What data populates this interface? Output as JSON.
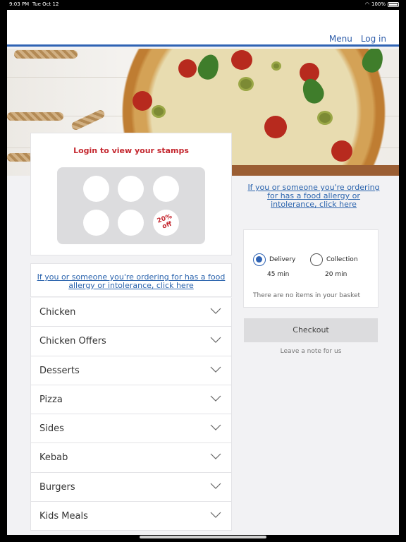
{
  "status_bar": {
    "time": "9:03 PM",
    "date": "Tue Oct 12",
    "battery": "100%"
  },
  "header": {
    "menu_label": "Menu",
    "login_label": "Log in",
    "accent_color": "#2f63b4"
  },
  "stamps": {
    "title": "Login to view your stamps",
    "offer_line1": "20%",
    "offer_line2": "off"
  },
  "allergy_notice": "If you or someone you're ordering for has a food allergy or intolerance, click here",
  "menu_categories": [
    {
      "label": "Chicken"
    },
    {
      "label": "Chicken Offers"
    },
    {
      "label": "Desserts"
    },
    {
      "label": "Pizza"
    },
    {
      "label": "Sides"
    },
    {
      "label": "Kebab"
    },
    {
      "label": "Burgers"
    },
    {
      "label": "Kids Meals"
    }
  ],
  "order": {
    "delivery_label": "Delivery",
    "delivery_time": "45 min",
    "collection_label": "Collection",
    "collection_time": "20 min",
    "selected": "delivery",
    "basket_empty": "There are no items in your basket"
  },
  "checkout_label": "Checkout",
  "note_label": "Leave a note for us"
}
